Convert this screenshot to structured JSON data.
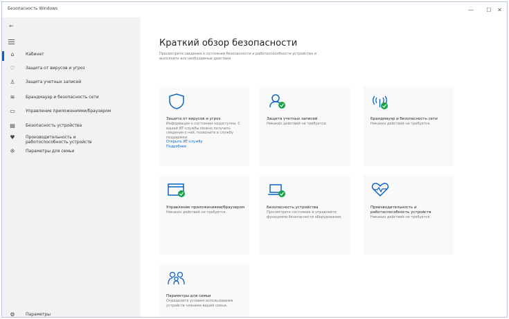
{
  "window": {
    "title": "Безопасность Windows",
    "controls": [
      "—",
      "☐",
      "✕"
    ]
  },
  "sidebar": {
    "back_icon": "back-arrow-icon",
    "menu_icon": "hamburger-icon",
    "items": [
      {
        "icon": "⌂",
        "icon_name": "home-icon",
        "label": "Кабинет"
      },
      {
        "icon": "♡",
        "icon_name": "shield-icon",
        "label": "Защита от вирусов и угроз"
      },
      {
        "icon": "♙",
        "icon_name": "person-icon",
        "label": "Защита учетных записей"
      },
      {
        "icon": "≋",
        "icon_name": "wifi-icon",
        "label": "Брандмауэр и безопасность сети"
      },
      {
        "icon": "▭",
        "icon_name": "app-browser-icon",
        "label": "Управление приложениями/браузером"
      },
      {
        "icon": "▤",
        "icon_name": "device-icon",
        "label": "Безопасность устройства"
      },
      {
        "icon": "♥",
        "icon_name": "heart-icon",
        "label": "Производительность и работоспособность устройств"
      },
      {
        "icon": "ꔮ",
        "icon_name": "family-icon",
        "label": "Параметры для семьи"
      }
    ],
    "settings": {
      "icon": "⚙",
      "icon_name": "gear-icon",
      "label": "Параметры"
    }
  },
  "main": {
    "title": "Краткий обзор безопасности",
    "description": "Просмотрите сведения о состоянии безопасности и работоспособности устройства и выполните все необходимые действия.",
    "tiles": [
      {
        "icon_name": "shield-icon",
        "title": "Защита от вирусов и угроз",
        "text": "Информация о состоянии недоступна. С вашей ИТ-службы можно получить сведения о ней, позвоните в службу поддержки.",
        "links": [
          "Открыть ИТ-службу",
          "Подробнее"
        ]
      },
      {
        "icon_name": "account-protection-icon",
        "title": "Защита учетных записей",
        "text": "Никаких действий не требуется.",
        "links": []
      },
      {
        "icon_name": "firewall-icon",
        "title": "Брандмауэр и безопасность сети",
        "text": "Никаких действий не требуется.",
        "links": []
      },
      {
        "icon_name": "app-browser-icon",
        "title": "Управление приложениями/браузером",
        "text": "Никаких действий не требуется.",
        "links": []
      },
      {
        "icon_name": "device-security-icon",
        "title": "Безопасность устройства",
        "text": "Просмотрите состояние и управляйте функциями безопасности оборудования.",
        "links": []
      },
      {
        "icon_name": "device-health-icon",
        "title": "Производительность и работоспособность устройств",
        "text": "Никаких действий не требуется.",
        "links": []
      },
      {
        "icon_name": "family-options-icon",
        "title": "Параметры для семьи",
        "text": "Определите условия использования устройств членами вашей семьи.",
        "links": []
      }
    ]
  },
  "colors": {
    "accent": "#0a62c4",
    "status_ok": "#16a34a",
    "sidebar_bg": "#f2f2f2",
    "tile_bg": "#f9f9f9"
  }
}
